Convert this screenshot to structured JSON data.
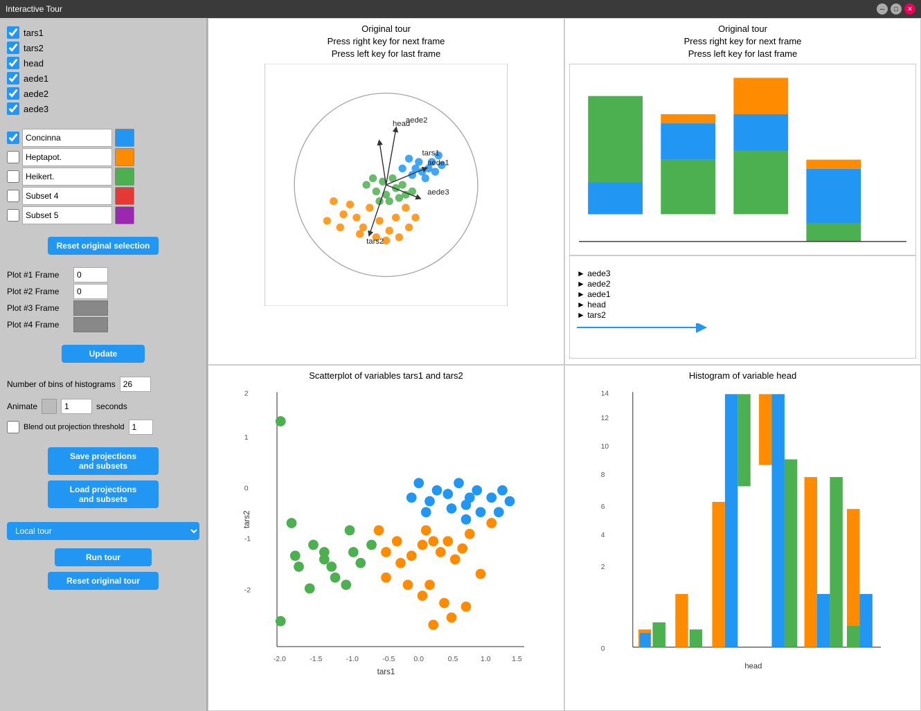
{
  "titlebar": {
    "title": "Interactive Tour"
  },
  "sidebar": {
    "variables": [
      {
        "label": "tars1",
        "checked": true
      },
      {
        "label": "tars2",
        "checked": true
      },
      {
        "label": "head",
        "checked": true
      },
      {
        "label": "aede1",
        "checked": true
      },
      {
        "label": "aede2",
        "checked": true
      },
      {
        "label": "aede3",
        "checked": true
      }
    ],
    "subsets": [
      {
        "name": "Concinna",
        "color": "#2196F3",
        "checked": true
      },
      {
        "name": "Heptapot.",
        "color": "#FF8C00",
        "checked": false
      },
      {
        "name": "Heikert.",
        "color": "#4CAF50",
        "checked": false
      },
      {
        "name": "Subset 4",
        "color": "#e53935",
        "checked": false
      },
      {
        "name": "Subset 5",
        "color": "#9C27B0",
        "checked": false
      }
    ],
    "reset_selection": "Reset original selection",
    "frames": [
      {
        "label": "Plot #1 Frame",
        "value": "0",
        "gray": false
      },
      {
        "label": "Plot #2 Frame",
        "value": "0",
        "gray": false
      },
      {
        "label": "Plot #3 Frame",
        "value": "",
        "gray": true
      },
      {
        "label": "Plot #4 Frame",
        "value": "",
        "gray": true
      }
    ],
    "update_btn": "Update",
    "bins_label": "Number of bins of histograms",
    "bins_value": "26",
    "animate_label": "Animate",
    "animate_seconds": "1",
    "seconds_label": "seconds",
    "blend_label": "Blend out projection threshold",
    "blend_value": "1",
    "save_btn": "Save projections\nand subsets",
    "load_btn": "Load projections\nand subsets",
    "tour_type": "Local tour",
    "run_btn": "Run tour",
    "reset_tour_btn": "Reset original tour"
  },
  "plots": {
    "top_left_title": "Original tour\nPress right key for next frame\nPress left key for last frame",
    "top_right_title": "Original tour\nPress right key for next frame\nPress left key for last frame",
    "bottom_left_title": "Scatterplot of variables tars1 and tars2",
    "bottom_right_title": "Histogram of variable head"
  },
  "legend": {
    "items": [
      "aede3",
      "aede2",
      "aede1",
      "head",
      "tars2"
    ]
  }
}
